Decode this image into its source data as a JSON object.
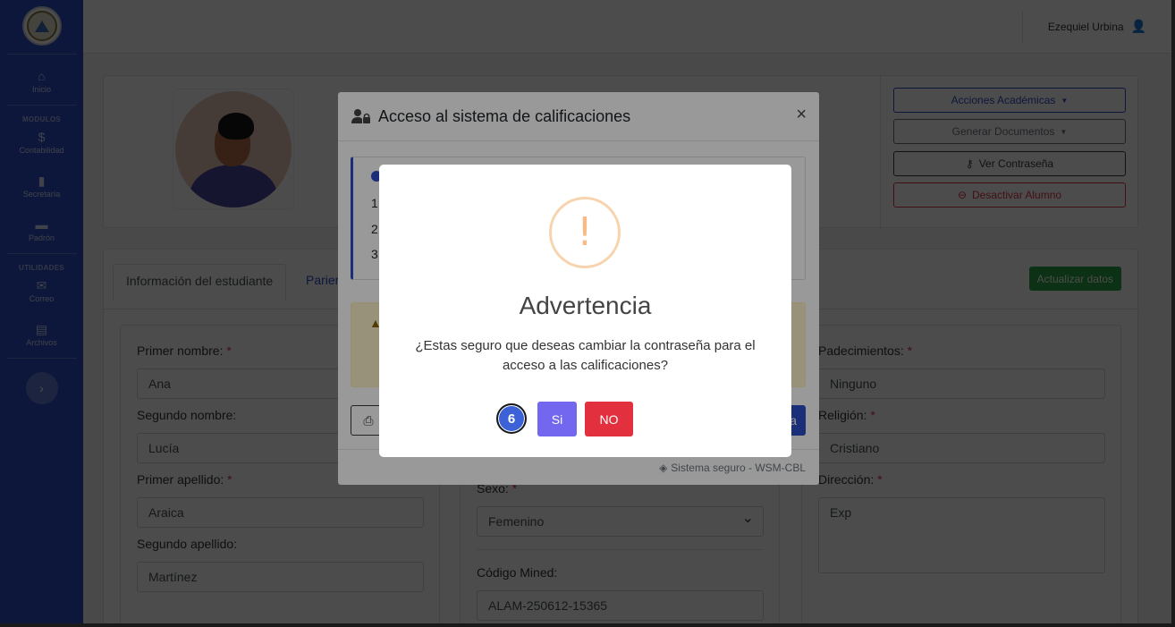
{
  "sidebar": {
    "items": [
      {
        "icon": "home-icon",
        "glyph": "⌂",
        "label": "Inicio"
      },
      {
        "icon": "dollar-icon",
        "glyph": "$",
        "label": "Contabilidad"
      },
      {
        "icon": "books-icon",
        "glyph": "▮",
        "label": "Secretaría"
      },
      {
        "icon": "folder-icon",
        "glyph": "▬",
        "label": "Padrón"
      },
      {
        "icon": "envelope-icon",
        "glyph": "✉",
        "label": "Correo"
      },
      {
        "icon": "archive-icon",
        "glyph": "▤",
        "label": "Archivos"
      }
    ],
    "section_modulos": "MODULOS",
    "section_utilidades": "UTILIDADES",
    "toggle_glyph": "›"
  },
  "topbar": {
    "user_name": "Ezequiel Urbina",
    "user_icon": "👤"
  },
  "profile": {
    "actions": [
      {
        "label": "Acciones Académicas",
        "glyph": "▼"
      },
      {
        "label": "Generar Documentos",
        "glyph": "▼"
      },
      {
        "label": "Ver Contraseña",
        "glyph": "⚷"
      },
      {
        "label": "Desactivar Alumno",
        "glyph": "⊖"
      }
    ]
  },
  "tabs": {
    "active": "Información del estudiante",
    "other": "Parier"
  },
  "update_button": "Actualizar datos",
  "form": {
    "primer_nombre_label": "Primer nombre:",
    "primer_nombre_value": "Ana",
    "segundo_nombre_label": "Segundo nombre:",
    "segundo_nombre_value": "Lucía",
    "primer_apellido_label": "Primer apellido:",
    "primer_apellido_value": "Araica",
    "segundo_apellido_label": "Segundo apellido:",
    "segundo_apellido_value": "Martínez",
    "sexo_label": "Sexo:",
    "sexo_value": "Femenino",
    "codigo_label": "Código Mined:",
    "codigo_value": "ALAM-250612-15365",
    "padecimientos_label": "Padecimientos:",
    "padecimientos_value": "Ninguno",
    "religion_label": "Religión:",
    "religion_value": "Cristiano",
    "direccion_label": "Dirección:",
    "direccion_value": "Exp",
    "required_mark": "*"
  },
  "modal": {
    "title": "Acceso al sistema de calificaciones",
    "close_glyph": "×",
    "list": [
      "1.",
      "2.",
      "3."
    ],
    "footer": "Sistema seguro - WSM-CBL",
    "footer_icon": "◈",
    "blue_btn_fragment": "a",
    "print_glyph": "⎙",
    "warning_glyph": "▲"
  },
  "alert": {
    "icon_glyph": "!",
    "title": "Advertencia",
    "text": "¿Estas seguro que deseas cambiar la contraseña para el acceso a las calificaciones?",
    "timer": "6",
    "confirm": "Si",
    "cancel": "NO"
  }
}
